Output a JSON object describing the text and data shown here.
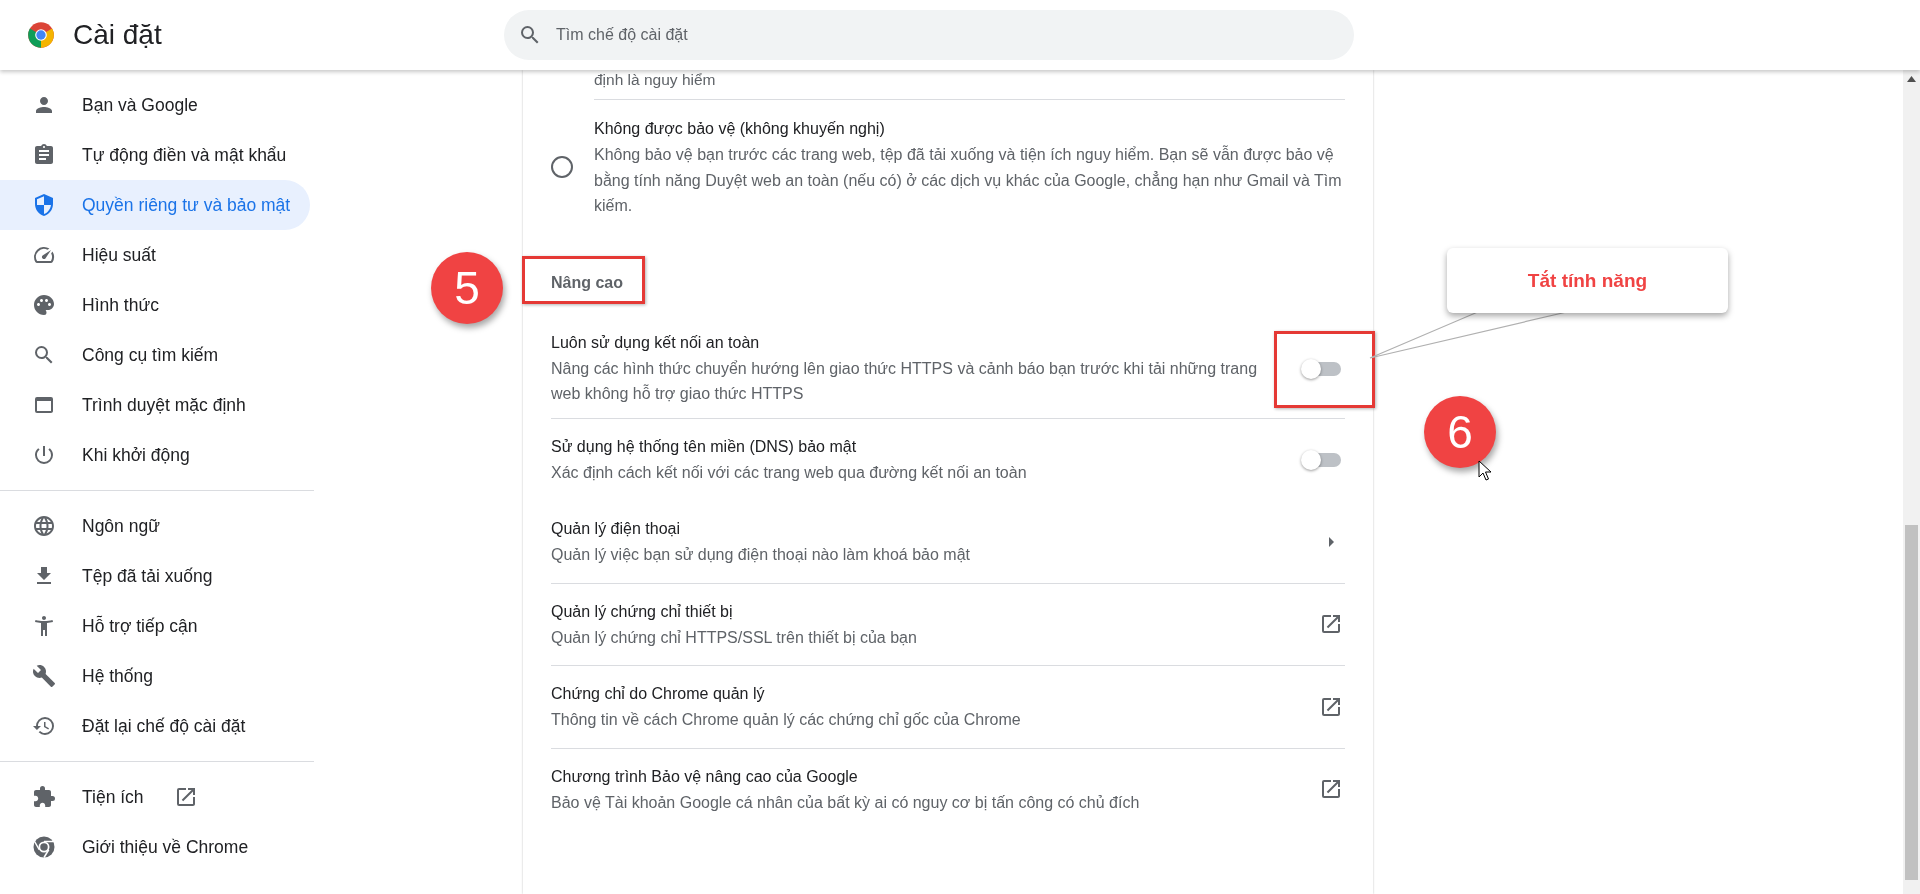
{
  "header": {
    "title": "Cài đặt",
    "search": {
      "placeholder": "Tìm chế độ cài đặt"
    }
  },
  "sidebar": {
    "groups": [
      {
        "items": [
          {
            "label": "Bạn và Google",
            "kind": "page",
            "selected": false
          },
          {
            "label": "Tự động điền và mật khẩu",
            "kind": "page",
            "selected": false
          },
          {
            "label": "Quyền riêng tư và bảo mật",
            "kind": "page",
            "selected": true
          },
          {
            "label": "Hiệu suất",
            "kind": "page",
            "selected": false
          },
          {
            "label": "Hình thức",
            "kind": "page",
            "selected": false
          },
          {
            "label": "Công cụ tìm kiếm",
            "kind": "page",
            "selected": false
          },
          {
            "label": "Trình duyệt mặc định",
            "kind": "page",
            "selected": false
          },
          {
            "label": "Khi khởi động",
            "kind": "page",
            "selected": false
          }
        ]
      },
      {
        "items": [
          {
            "label": "Ngôn ngữ",
            "kind": "page",
            "selected": false
          },
          {
            "label": "Tệp đã tải xuống",
            "kind": "page",
            "selected": false
          },
          {
            "label": "Hỗ trợ tiếp cận",
            "kind": "page",
            "selected": false
          },
          {
            "label": "Hệ thống",
            "kind": "page",
            "selected": false
          },
          {
            "label": "Đặt lại chế độ cài đặt",
            "kind": "page",
            "selected": false
          }
        ]
      },
      {
        "items": [
          {
            "label": "Tiện ích",
            "kind": "external",
            "selected": false
          },
          {
            "label": "Giới thiệu về Chrome",
            "kind": "page",
            "selected": false
          }
        ]
      }
    ]
  },
  "content": {
    "cut_text": "định là nguy hiểm",
    "radio_option": {
      "title": "Không được bảo vệ (không khuyến nghị)",
      "description": "Không bảo vệ bạn trước các trang web, tệp đã tải xuống và tiện ích nguy hiểm. Bạn sẽ vẫn được bảo vệ bằng tính năng Duyệt web an toàn (nếu có) ở các dịch vụ khác của Google, chẳng hạn như Gmail và Tìm kiếm.",
      "selected": false
    },
    "section_heading": "Nâng cao",
    "rows": [
      {
        "title": "Luôn sử dụng kết nối an toàn",
        "description": "Nâng các hình thức chuyển hướng lên giao thức HTTPS và cảnh báo bạn trước khi tải những trang web không hỗ trợ giao thức HTTPS",
        "kind": "toggle",
        "on": false,
        "divider_above": false
      },
      {
        "title": "Sử dụng hệ thống tên miền (DNS) bảo mật",
        "description": "Xác định cách kết nối với các trang web qua đường kết nối an toàn",
        "kind": "toggle",
        "on": false,
        "divider_above": true
      },
      {
        "title": "Quản lý điện thoại",
        "description": "Quản lý việc bạn sử dụng điện thoại nào làm khoá bảo mật",
        "kind": "submenu",
        "divider_above": false
      },
      {
        "title": "Quản lý chứng chỉ thiết bị",
        "description": "Quản lý chứng chỉ HTTPS/SSL trên thiết bị của bạn",
        "kind": "external",
        "divider_above": true
      },
      {
        "title": "Chứng chỉ do Chrome quản lý",
        "description": "Thông tin về cách Chrome quản lý các chứng chỉ gốc của Chrome",
        "kind": "external",
        "divider_above": true
      },
      {
        "title": "Chương trình Bảo vệ nâng cao của Google",
        "description": "Bảo vệ Tài khoản Google cá nhân của bất kỳ ai có nguy cơ bị tấn công có chủ đích",
        "kind": "external",
        "divider_above": true
      }
    ]
  },
  "annotations": {
    "step_badges": [
      "5",
      "6"
    ],
    "callout": "Tắt tính năng"
  }
}
